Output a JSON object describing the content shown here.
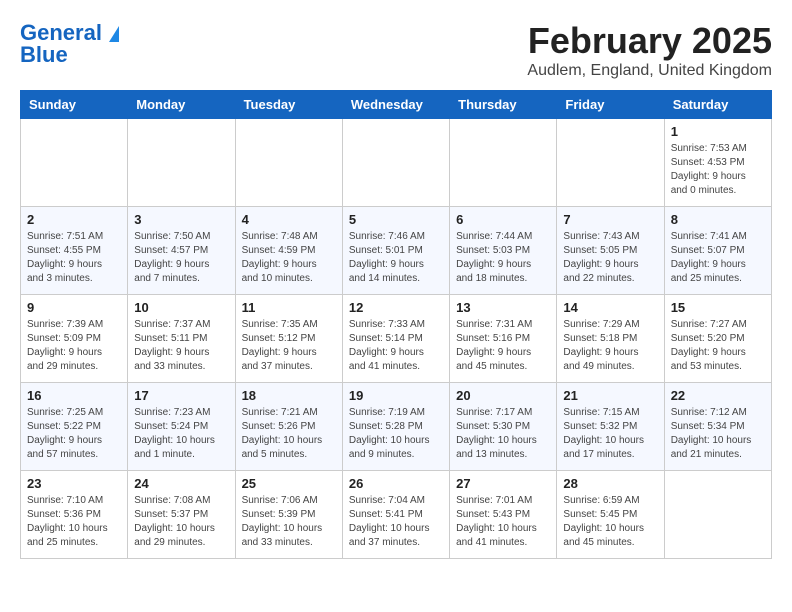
{
  "header": {
    "logo_general": "General",
    "logo_blue": "Blue",
    "title": "February 2025",
    "subtitle": "Audlem, England, United Kingdom"
  },
  "calendar": {
    "days_of_week": [
      "Sunday",
      "Monday",
      "Tuesday",
      "Wednesday",
      "Thursday",
      "Friday",
      "Saturday"
    ],
    "weeks": [
      [
        {
          "day": "",
          "info": ""
        },
        {
          "day": "",
          "info": ""
        },
        {
          "day": "",
          "info": ""
        },
        {
          "day": "",
          "info": ""
        },
        {
          "day": "",
          "info": ""
        },
        {
          "day": "",
          "info": ""
        },
        {
          "day": "1",
          "info": "Sunrise: 7:53 AM\nSunset: 4:53 PM\nDaylight: 9 hours and 0 minutes."
        }
      ],
      [
        {
          "day": "2",
          "info": "Sunrise: 7:51 AM\nSunset: 4:55 PM\nDaylight: 9 hours and 3 minutes."
        },
        {
          "day": "3",
          "info": "Sunrise: 7:50 AM\nSunset: 4:57 PM\nDaylight: 9 hours and 7 minutes."
        },
        {
          "day": "4",
          "info": "Sunrise: 7:48 AM\nSunset: 4:59 PM\nDaylight: 9 hours and 10 minutes."
        },
        {
          "day": "5",
          "info": "Sunrise: 7:46 AM\nSunset: 5:01 PM\nDaylight: 9 hours and 14 minutes."
        },
        {
          "day": "6",
          "info": "Sunrise: 7:44 AM\nSunset: 5:03 PM\nDaylight: 9 hours and 18 minutes."
        },
        {
          "day": "7",
          "info": "Sunrise: 7:43 AM\nSunset: 5:05 PM\nDaylight: 9 hours and 22 minutes."
        },
        {
          "day": "8",
          "info": "Sunrise: 7:41 AM\nSunset: 5:07 PM\nDaylight: 9 hours and 25 minutes."
        }
      ],
      [
        {
          "day": "9",
          "info": "Sunrise: 7:39 AM\nSunset: 5:09 PM\nDaylight: 9 hours and 29 minutes."
        },
        {
          "day": "10",
          "info": "Sunrise: 7:37 AM\nSunset: 5:11 PM\nDaylight: 9 hours and 33 minutes."
        },
        {
          "day": "11",
          "info": "Sunrise: 7:35 AM\nSunset: 5:12 PM\nDaylight: 9 hours and 37 minutes."
        },
        {
          "day": "12",
          "info": "Sunrise: 7:33 AM\nSunset: 5:14 PM\nDaylight: 9 hours and 41 minutes."
        },
        {
          "day": "13",
          "info": "Sunrise: 7:31 AM\nSunset: 5:16 PM\nDaylight: 9 hours and 45 minutes."
        },
        {
          "day": "14",
          "info": "Sunrise: 7:29 AM\nSunset: 5:18 PM\nDaylight: 9 hours and 49 minutes."
        },
        {
          "day": "15",
          "info": "Sunrise: 7:27 AM\nSunset: 5:20 PM\nDaylight: 9 hours and 53 minutes."
        }
      ],
      [
        {
          "day": "16",
          "info": "Sunrise: 7:25 AM\nSunset: 5:22 PM\nDaylight: 9 hours and 57 minutes."
        },
        {
          "day": "17",
          "info": "Sunrise: 7:23 AM\nSunset: 5:24 PM\nDaylight: 10 hours and 1 minute."
        },
        {
          "day": "18",
          "info": "Sunrise: 7:21 AM\nSunset: 5:26 PM\nDaylight: 10 hours and 5 minutes."
        },
        {
          "day": "19",
          "info": "Sunrise: 7:19 AM\nSunset: 5:28 PM\nDaylight: 10 hours and 9 minutes."
        },
        {
          "day": "20",
          "info": "Sunrise: 7:17 AM\nSunset: 5:30 PM\nDaylight: 10 hours and 13 minutes."
        },
        {
          "day": "21",
          "info": "Sunrise: 7:15 AM\nSunset: 5:32 PM\nDaylight: 10 hours and 17 minutes."
        },
        {
          "day": "22",
          "info": "Sunrise: 7:12 AM\nSunset: 5:34 PM\nDaylight: 10 hours and 21 minutes."
        }
      ],
      [
        {
          "day": "23",
          "info": "Sunrise: 7:10 AM\nSunset: 5:36 PM\nDaylight: 10 hours and 25 minutes."
        },
        {
          "day": "24",
          "info": "Sunrise: 7:08 AM\nSunset: 5:37 PM\nDaylight: 10 hours and 29 minutes."
        },
        {
          "day": "25",
          "info": "Sunrise: 7:06 AM\nSunset: 5:39 PM\nDaylight: 10 hours and 33 minutes."
        },
        {
          "day": "26",
          "info": "Sunrise: 7:04 AM\nSunset: 5:41 PM\nDaylight: 10 hours and 37 minutes."
        },
        {
          "day": "27",
          "info": "Sunrise: 7:01 AM\nSunset: 5:43 PM\nDaylight: 10 hours and 41 minutes."
        },
        {
          "day": "28",
          "info": "Sunrise: 6:59 AM\nSunset: 5:45 PM\nDaylight: 10 hours and 45 minutes."
        },
        {
          "day": "",
          "info": ""
        }
      ]
    ]
  }
}
